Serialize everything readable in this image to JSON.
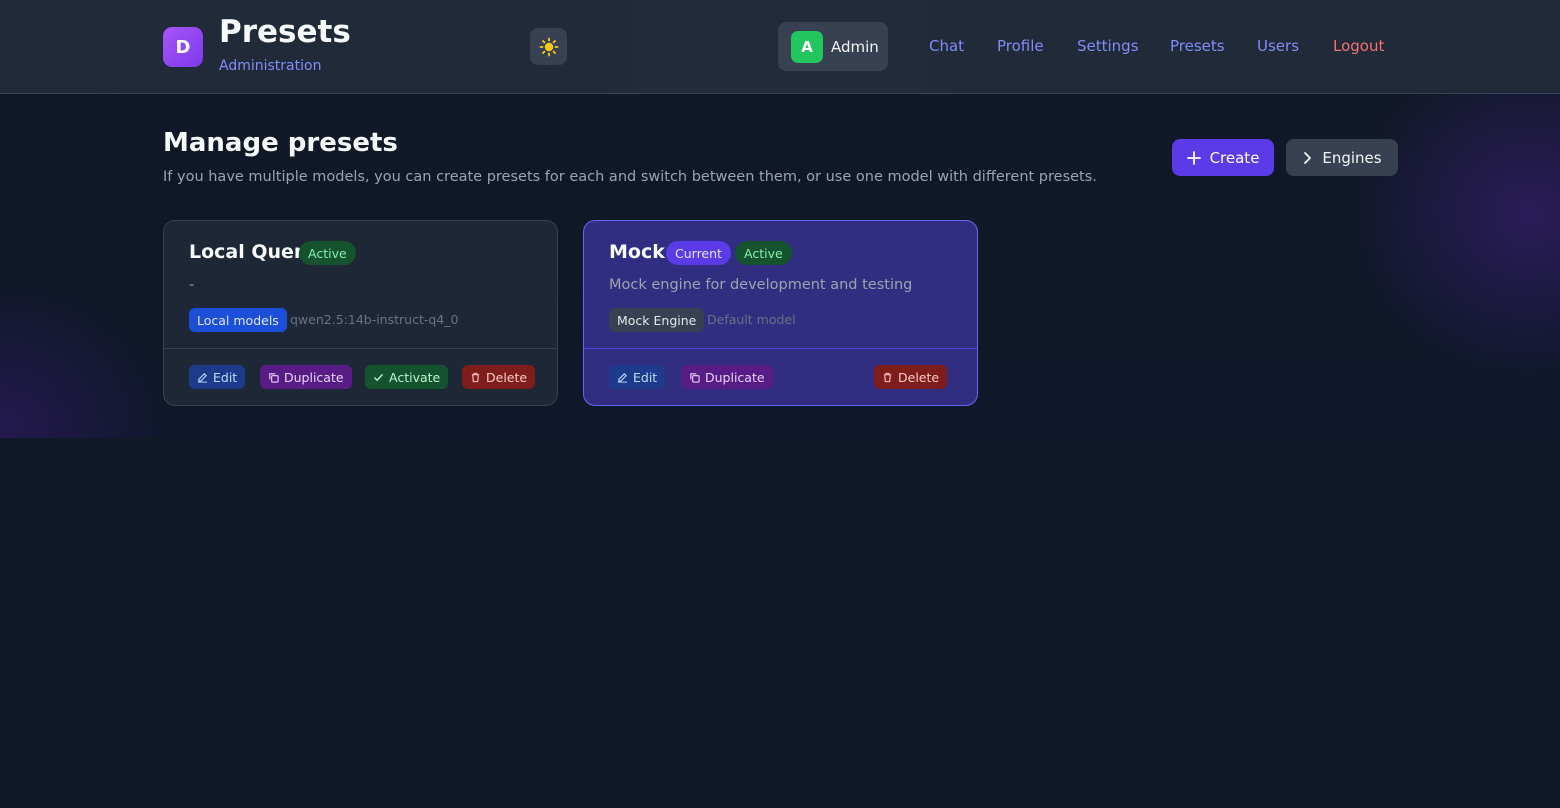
{
  "header": {
    "logo_letter": "D",
    "title": "Presets",
    "subtitle": "Administration",
    "theme_icon": "sun-icon",
    "user": {
      "avatar_letter": "A",
      "name": "Admin"
    },
    "nav": [
      "Chat",
      "Profile",
      "Settings",
      "Presets",
      "Users",
      "Logout"
    ]
  },
  "main": {
    "title": "Manage presets",
    "description": "If you have multiple models, you can create presets for each and switch between them, or use one model with different presets.",
    "create_label": "Create",
    "engines_label": "Engines"
  },
  "presets": [
    {
      "name": "Local Quen",
      "badges": [
        "Active"
      ],
      "description": "-",
      "engine": "Local models",
      "model": "qwen2.5:14b-instruct-q4_0",
      "actions": [
        "Edit",
        "Duplicate",
        "Activate",
        "Delete"
      ]
    },
    {
      "name": "Mock",
      "badges": [
        "Current",
        "Active"
      ],
      "description": "Mock engine for development and testing",
      "engine": "Mock Engine",
      "model": "Default model",
      "actions": [
        "Edit",
        "Duplicate",
        "Delete"
      ]
    }
  ],
  "colors": {
    "background": "#111827",
    "header": "#1f2937",
    "accent": "#5b3be8",
    "nav_link": "#818cf8",
    "logout": "#f87171",
    "active_badge": "#14532d",
    "current_card": "#312e81"
  }
}
